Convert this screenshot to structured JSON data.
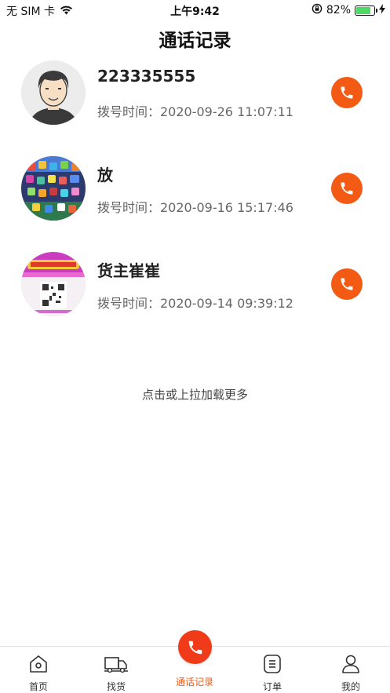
{
  "status_bar": {
    "carrier": "无 SIM 卡",
    "time": "上午9:42",
    "battery_percent": "82%",
    "battery_level": 0.82,
    "wifi_icon": "wifi-icon",
    "lock_icon": "orientation-lock-icon",
    "charging_icon": "charging-icon"
  },
  "header": {
    "title": "通话记录"
  },
  "calls": [
    {
      "name": "223335555",
      "time": "拨号时间：2020-09-26 11:07:11",
      "avatar": "cartoon-man-avatar"
    },
    {
      "name": "放",
      "time": "拨号时间：2020-09-16 15:17:46",
      "avatar": "app-icons-collage-avatar"
    },
    {
      "name": "货主崔崔",
      "time": "拨号时间：2020-09-14 09:39:12",
      "avatar": "qr-poster-avatar"
    }
  ],
  "load_more": "点击或上拉加载更多",
  "tab_bar": {
    "home": "首页",
    "find_goods": "找货",
    "call_log": "通话记录",
    "orders": "订单",
    "mine": "我的"
  },
  "colors": {
    "accent": "#f35a14",
    "center_button": "#f03b1a",
    "battery": "#4cd964"
  }
}
